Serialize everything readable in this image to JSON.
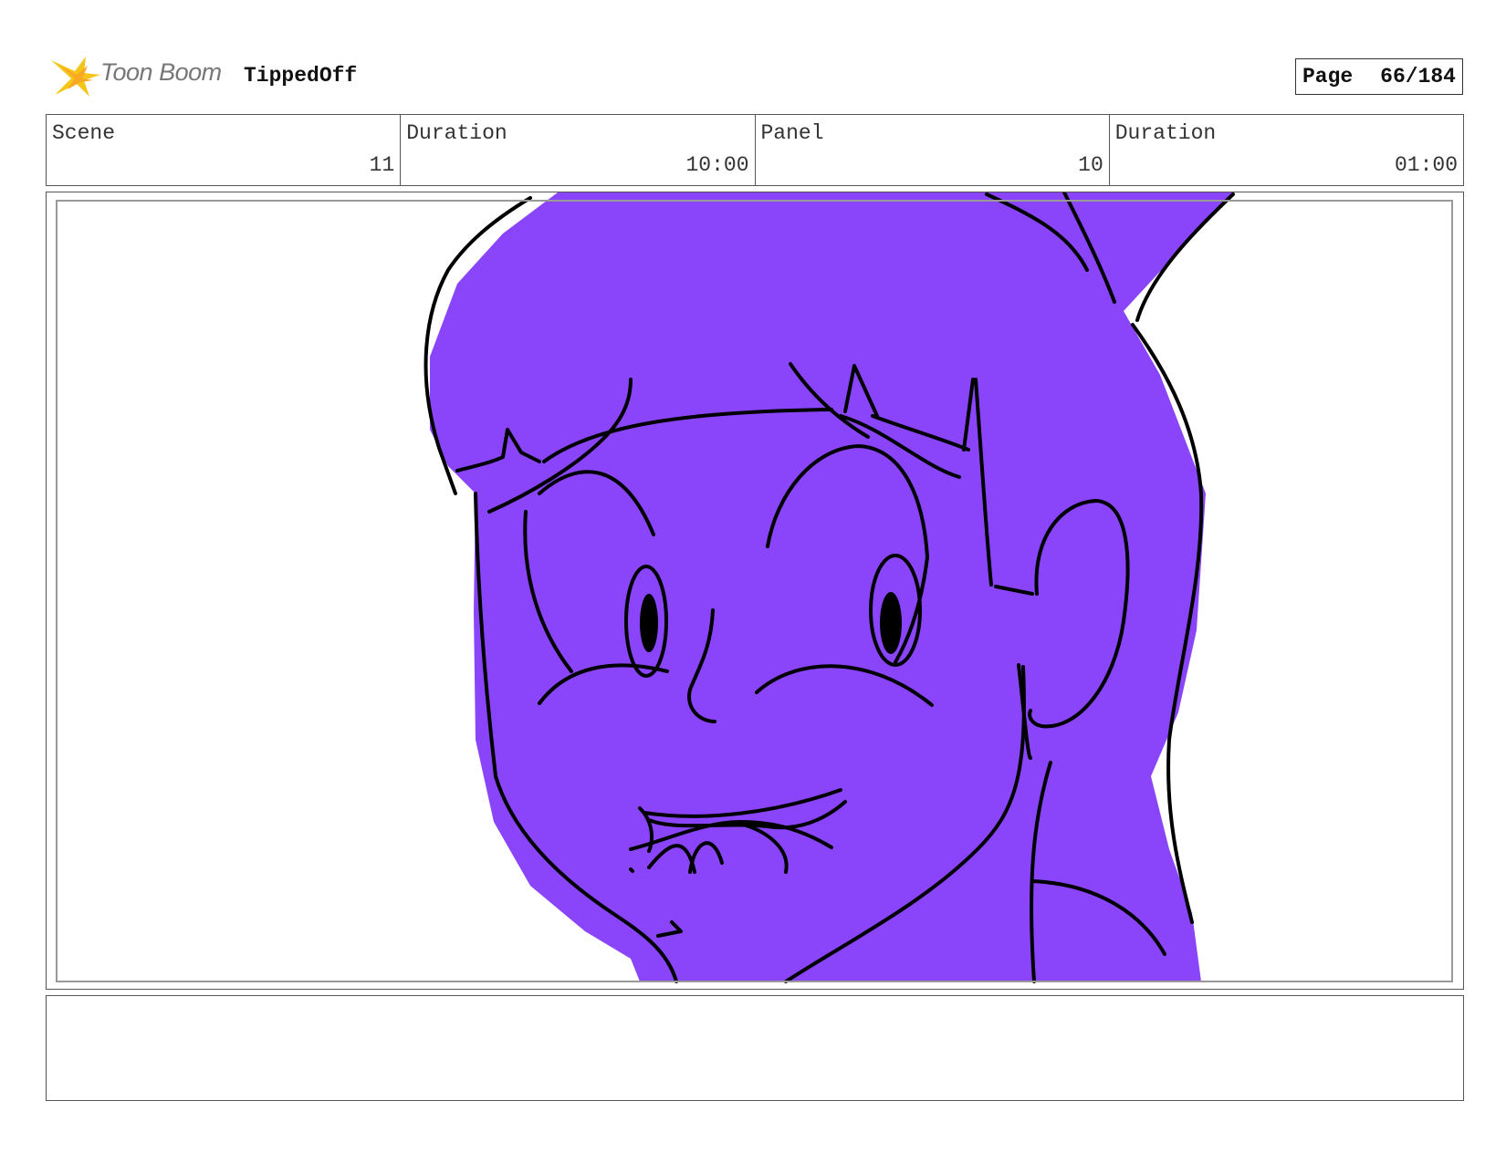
{
  "header": {
    "brand": "Toon Boom",
    "project_title": "TippedOff",
    "page_label": "Page",
    "page_value": "66/184"
  },
  "info": {
    "scene_label": "Scene",
    "scene_value": "11",
    "scene_duration_label": "Duration",
    "scene_duration_value": "10:00",
    "panel_label": "Panel",
    "panel_value": "10",
    "panel_duration_label": "Duration",
    "panel_duration_value": "01:00"
  },
  "colors": {
    "fill": "#8a45fa",
    "ink": "#000000",
    "logo_yellow": "#f5c518"
  },
  "notes": {
    "text": ""
  }
}
